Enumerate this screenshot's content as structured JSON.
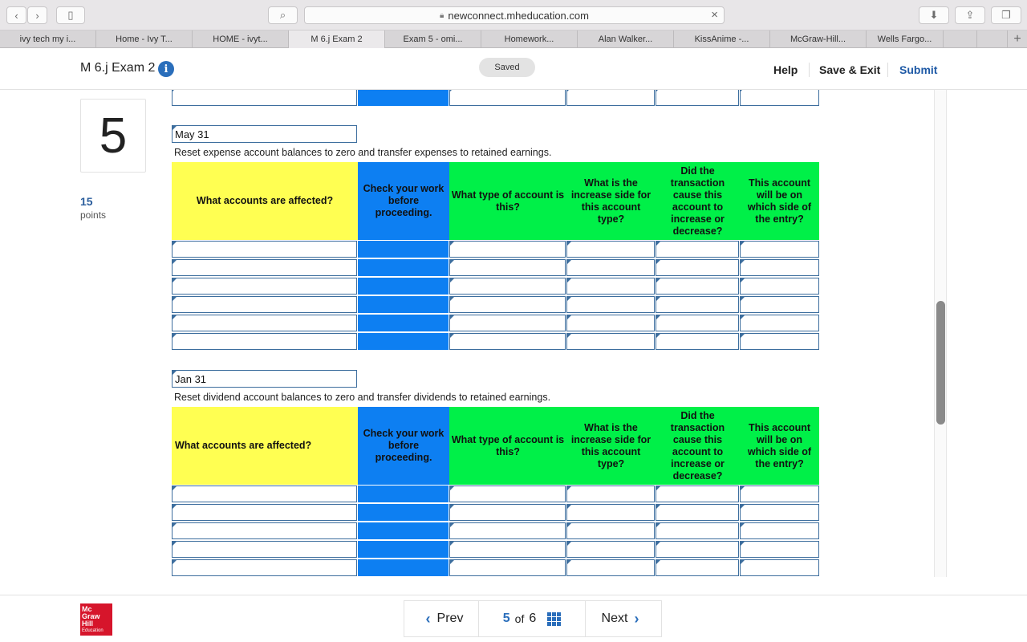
{
  "browser": {
    "url": "newconnect.mheducation.com",
    "tabs": [
      "ivy tech my i...",
      "Home - Ivy T...",
      "HOME - ivyt...",
      "M 6.j Exam 2",
      "Exam 5 - omi...",
      "Homework...",
      "Alan Walker...",
      "KissAnime -...",
      "McGraw-Hill...",
      "Wells Fargo..."
    ],
    "active_tab": 3
  },
  "header": {
    "title": "M 6.j Exam 2",
    "saved_label": "Saved",
    "help_label": "Help",
    "save_exit_label": "Save & Exit",
    "submit_label": "Submit"
  },
  "question": {
    "number": "5",
    "points": "15",
    "points_label": "points"
  },
  "table_headers": [
    "What accounts are affected?",
    "Check your work before proceeding.",
    "What type of account is this?",
    "What is the increase side for this account type?",
    "Did the transaction cause this account to increase or decrease?",
    "This account will be on which side of the entry?"
  ],
  "sections": [
    {
      "date": "May 31",
      "instruction": "Reset expense account balances to zero and transfer expenses to retained earnings.",
      "rows": 6
    },
    {
      "date": "Jan 31",
      "instruction": "Reset dividend account balances to zero and transfer dividends to retained earnings.",
      "rows": 6
    }
  ],
  "footer": {
    "prev_label": "Prev",
    "next_label": "Next",
    "current_page": "5",
    "of_label": "of",
    "total_pages": "6",
    "logo_lines": [
      "Mc",
      "Graw",
      "Hill",
      "Education"
    ]
  }
}
